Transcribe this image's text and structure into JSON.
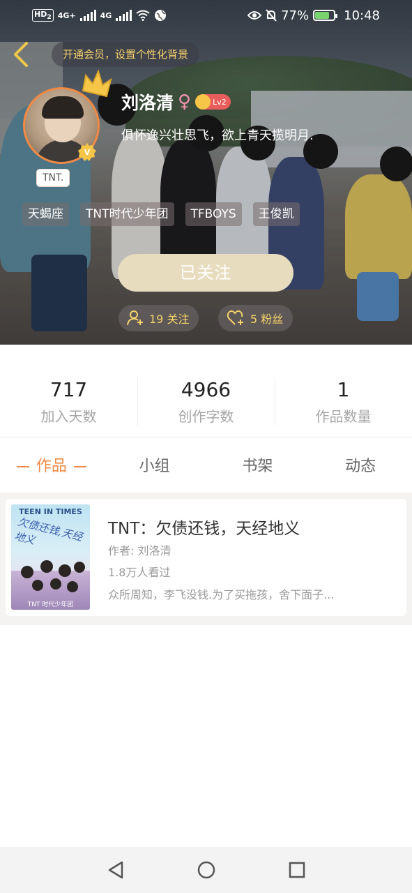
{
  "status_bar": {
    "hd_label": "HD",
    "hd_sub": "2",
    "signal1_label": "4G+",
    "signal2_label": "4G",
    "battery_percent": "77%",
    "battery_level": 0.77,
    "time": "10:48"
  },
  "header": {
    "vip_promo": "开通会员，设置个性化背景"
  },
  "profile": {
    "name": "刘洛清",
    "gender_symbol": "♀",
    "level": "Lv2",
    "signature": "俱怀逸兴壮思飞，欲上青天揽明月.",
    "badge_letter": "V",
    "group_tag": "TNT.",
    "tags": [
      "天蝎座",
      "TNT时代少年团",
      "TFBOYS",
      "王俊凯"
    ],
    "follow_button": "已关注",
    "following_label": "19 关注",
    "fans_label": "5 粉丝"
  },
  "stats": [
    {
      "value": "717",
      "label": "加入天数"
    },
    {
      "value": "4966",
      "label": "创作字数"
    },
    {
      "value": "1",
      "label": "作品数量"
    }
  ],
  "tabs": [
    {
      "label": "作品",
      "active": true
    },
    {
      "label": "小组",
      "active": false
    },
    {
      "label": "书架",
      "active": false
    },
    {
      "label": "动态",
      "active": false
    }
  ],
  "works": [
    {
      "cover_title": "TEEN IN TIMES",
      "cover_cn": "欠债还钱,天经地义",
      "cover_foot": "TNT 时代少年团",
      "title": "TNT：欠债还钱，天经地义",
      "author": "作者: 刘洛清",
      "views": "1.8万人看过",
      "description": "众所周知，李飞没钱.为了买拖孩，舍下面子..."
    }
  ],
  "colors": {
    "accent": "#f08a45",
    "gold": "#f6d36b",
    "follow_button": "#e8dcbf",
    "level_badge": "#e95c5c"
  },
  "icons": {
    "back": "chevron-left-icon",
    "crown": "crown-icon",
    "verified": "v-badge-icon",
    "following": "person-add-icon",
    "fans": "heart-add-icon",
    "nav_back": "triangle-back-icon",
    "nav_home": "circle-home-icon",
    "nav_recents": "square-recents-icon"
  }
}
